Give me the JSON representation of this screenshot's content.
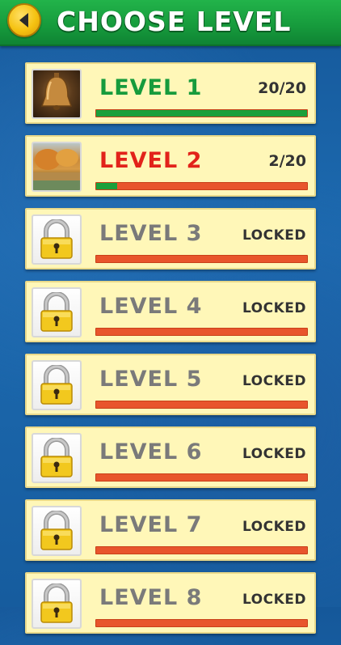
{
  "header": {
    "title": "CHOOSE LEVEL",
    "back_icon": "back-arrow-icon"
  },
  "colors": {
    "header_green": "#169a3c",
    "card_bg": "#fff7b8",
    "progress_complete": "#1a9f3b",
    "progress_remaining": "#e8552c",
    "level_name_complete": "#169b3c",
    "level_name_current": "#e2231a",
    "level_name_locked": "#7a7a7a"
  },
  "levels": [
    {
      "name": "LEVEL 1",
      "status": "20/20",
      "progress": 1.0,
      "state": "complete",
      "thumbnail": "bell-photo"
    },
    {
      "name": "LEVEL 2",
      "status": "2/20",
      "progress": 0.1,
      "state": "current",
      "thumbnail": "autumn-lake-photo"
    },
    {
      "name": "LEVEL 3",
      "status": "LOCKED",
      "progress": 0,
      "state": "locked",
      "thumbnail": "padlock-icon"
    },
    {
      "name": "LEVEL 4",
      "status": "LOCKED",
      "progress": 0,
      "state": "locked",
      "thumbnail": "padlock-icon"
    },
    {
      "name": "LEVEL 5",
      "status": "LOCKED",
      "progress": 0,
      "state": "locked",
      "thumbnail": "padlock-icon"
    },
    {
      "name": "LEVEL 6",
      "status": "LOCKED",
      "progress": 0,
      "state": "locked",
      "thumbnail": "padlock-icon"
    },
    {
      "name": "LEVEL 7",
      "status": "LOCKED",
      "progress": 0,
      "state": "locked",
      "thumbnail": "padlock-icon"
    },
    {
      "name": "LEVEL 8",
      "status": "LOCKED",
      "progress": 0,
      "state": "locked",
      "thumbnail": "padlock-icon"
    }
  ]
}
